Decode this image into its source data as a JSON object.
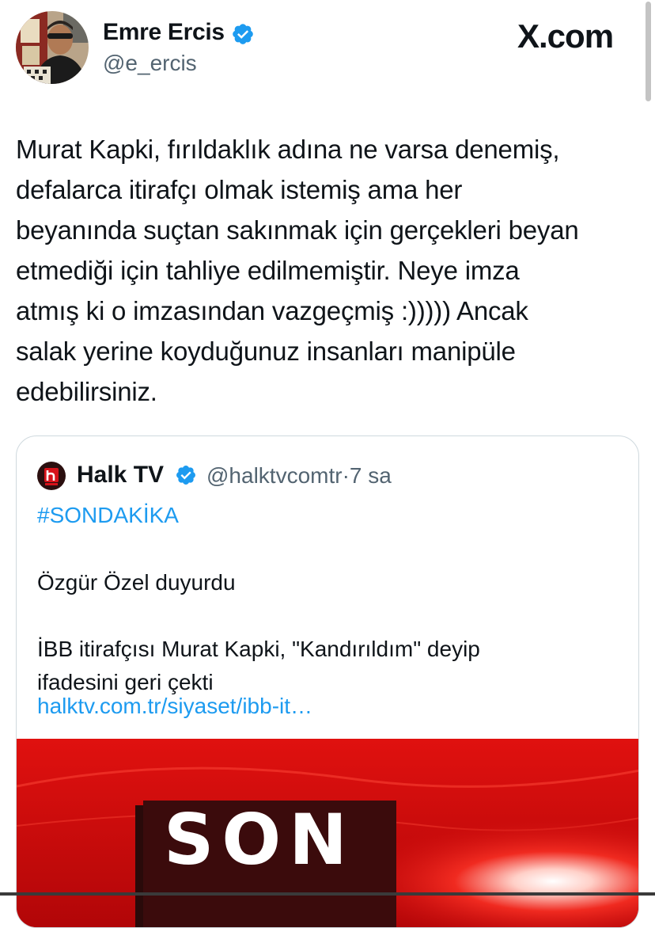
{
  "header": {
    "author_name": "Emre Ercis",
    "handle": "@e_ercis",
    "site_logo": "X.com",
    "verified_badge_icon": "verified-badge-icon",
    "avatar_icon": "avatar"
  },
  "tweet": {
    "text": "Murat Kapki, fırıldaklık adına ne varsa denemiş,\ndefalarca itirafçı olmak istemiş ama her\nbeyanında suçtan sakınmak için gerçekleri beyan\netmediği için tahliye edilmemiştir. Neye imza\natmış ki o imzasından vazgeçmiş :))))) Ancak\nsalak yerine koyduğunuz insanları manipüle\nedebilirsiniz."
  },
  "quote": {
    "name": "Halk TV",
    "handle": "@halktvcomtr",
    "separator": "·",
    "time": "7 sa",
    "hashtag": "#SONDAKİKA",
    "body": "Özgür Özel duyurdu\n\nİBB itirafçısı Murat Kapki, \"Kandırıldım\" deyip\nifadesini geri çekti",
    "link": "halktv.com.tr/siyaset/ibb-it…",
    "media_text": "SON"
  },
  "colors": {
    "accent_blue": "#1d9bf0",
    "secondary_text": "#536471",
    "breaking_red": "#c8080a"
  }
}
